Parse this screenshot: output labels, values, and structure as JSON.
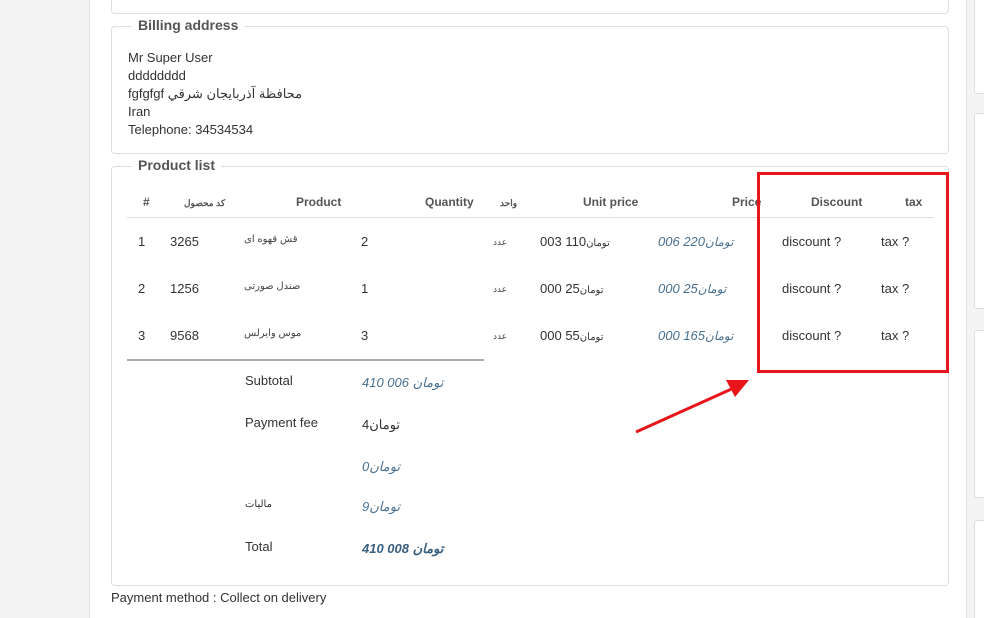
{
  "prev_box": {
    "stub": "(...)"
  },
  "billing": {
    "legend": "Billing address",
    "lines": [
      "Mr Super User",
      "dddddddd",
      "fgfgfgf محافظة آذربایجان شرقي",
      "Iran",
      "Telephone: 34534534"
    ]
  },
  "products": {
    "legend": "Product list",
    "headers": {
      "num": "#",
      "code": "کد محصول",
      "product": "Product",
      "quantity": "Quantity",
      "unit": "واحد",
      "unit_price": "Unit price",
      "price": "Price",
      "discount": "Discount",
      "tax": "tax"
    },
    "rows": [
      {
        "num": "1",
        "code": "3265",
        "name": "قش قهوه ای",
        "qty": "2",
        "unit": "عدد",
        "unit_price": "110 003",
        "unit_price_cur": "تومان",
        "price": "220 006",
        "price_cur": "تومان",
        "discount": "discount ?",
        "tax": "tax ?"
      },
      {
        "num": "2",
        "code": "1256",
        "name": "صندل صورتی",
        "qty": "1",
        "unit": "عدد",
        "unit_price": "25 000",
        "unit_price_cur": "تومان",
        "price": "25 000",
        "price_cur": "تومان",
        "discount": "discount ?",
        "tax": "tax ?"
      },
      {
        "num": "3",
        "code": "9568",
        "name": "موس وایرلس",
        "qty": "3",
        "unit": "عدد",
        "unit_price": "55 000",
        "unit_price_cur": "تومان",
        "price": "165 000",
        "price_cur": "تومان",
        "discount": "discount ?",
        "tax": "tax ?"
      }
    ],
    "totals": {
      "subtotal_label": "Subtotal",
      "subtotal_value": "410 006 تومان",
      "payment_fee_label": "Payment fee",
      "payment_fee_value": "4تومان",
      "blank_value": "0تومان",
      "tax_label": "مالیات",
      "tax_value": "9تومان",
      "total_label": "Total",
      "total_value": "410 008 تومان"
    }
  },
  "payment_method": "Payment method : Collect on delivery",
  "colors": {
    "highlight": "#e8161b",
    "price_text": "#4a7090",
    "border": "#dddddd"
  }
}
